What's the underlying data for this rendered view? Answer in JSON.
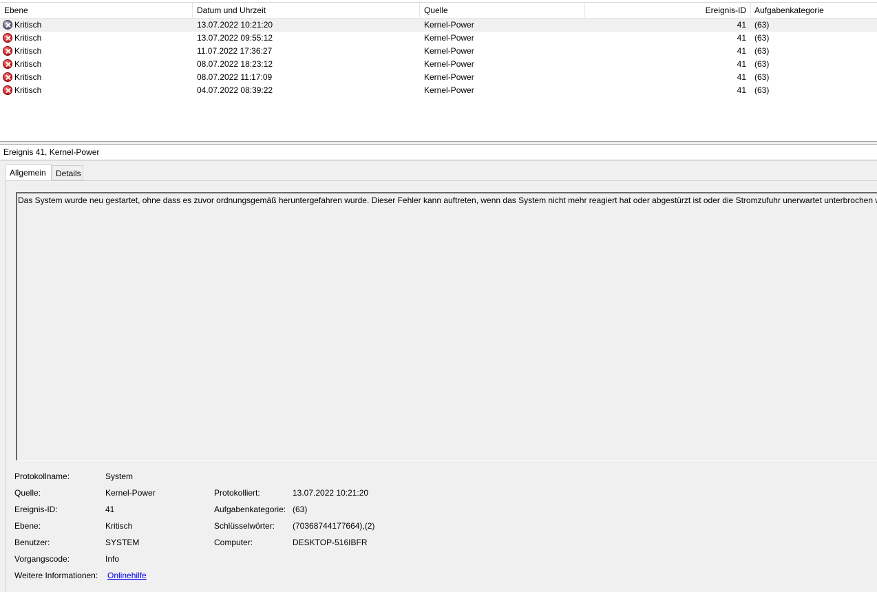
{
  "list": {
    "columns": [
      "Ebene",
      "Datum und Uhrzeit",
      "Quelle",
      "Ereignis-ID",
      "Aufgabenkategorie"
    ],
    "rows": [
      {
        "level": "Kritisch",
        "date": "13.07.2022 10:21:20",
        "source": "Kernel-Power",
        "id": "41",
        "category": "(63)"
      },
      {
        "level": "Kritisch",
        "date": "13.07.2022 09:55:12",
        "source": "Kernel-Power",
        "id": "41",
        "category": "(63)"
      },
      {
        "level": "Kritisch",
        "date": "11.07.2022 17:36:27",
        "source": "Kernel-Power",
        "id": "41",
        "category": "(63)"
      },
      {
        "level": "Kritisch",
        "date": "08.07.2022 18:23:12",
        "source": "Kernel-Power",
        "id": "41",
        "category": "(63)"
      },
      {
        "level": "Kritisch",
        "date": "08.07.2022 11:17:09",
        "source": "Kernel-Power",
        "id": "41",
        "category": "(63)"
      },
      {
        "level": "Kritisch",
        "date": "04.07.2022 08:39:22",
        "source": "Kernel-Power",
        "id": "41",
        "category": "(63)"
      }
    ]
  },
  "detail": {
    "title": "Ereignis 41, Kernel-Power",
    "tabs": [
      "Allgemein",
      "Details"
    ],
    "description": "Das System wurde neu gestartet, ohne dass es zuvor ordnungsgemäß heruntergefahren wurde. Dieser Fehler kann auftreten, wenn das System nicht mehr reagiert hat oder abgestürzt ist oder die Stromzufuhr unerwartet unterbrochen wurde.",
    "props": {
      "log_label": "Protokollname:",
      "log_value": "System",
      "source_label": "Quelle:",
      "source_value": "Kernel-Power",
      "logged_label": "Protokolliert:",
      "logged_value": "13.07.2022 10:21:20",
      "id_label": "Ereignis-ID:",
      "id_value": "41",
      "category_label": "Aufgabenkategorie:",
      "category_value": "(63)",
      "level_label": "Ebene:",
      "level_value": "Kritisch",
      "keywords_label": "Schlüsselwörter:",
      "keywords_value": "(70368744177664),(2)",
      "user_label": "Benutzer:",
      "user_value": "SYSTEM",
      "computer_label": "Computer:",
      "computer_value": "DESKTOP-516IBFR",
      "opcode_label": "Vorgangscode:",
      "opcode_value": "Info",
      "more_label": "Weitere Informationen:",
      "more_link": "Onlinehilfe"
    }
  },
  "icons": {
    "critical": "critical-error-icon"
  },
  "colors": {
    "selected_row": "#f0f0f0",
    "link": "#0000ee",
    "critical_red": "#dd3333"
  }
}
